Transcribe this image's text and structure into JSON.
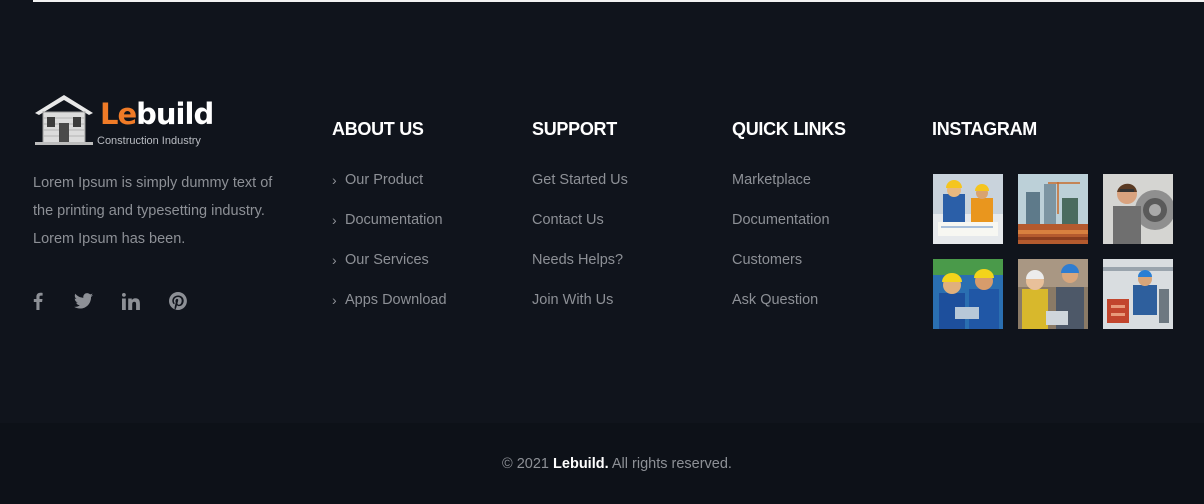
{
  "brand": {
    "logo_prefix": "Le",
    "logo_suffix": "build",
    "tagline": "Construction Industry",
    "about": "Lorem Ipsum is simply dummy text of the printing and typesetting industry. Lorem Ipsum has been.",
    "accent_color": "#f07b27"
  },
  "social": [
    {
      "name": "facebook",
      "icon": "facebook-icon"
    },
    {
      "name": "twitter",
      "icon": "twitter-icon"
    },
    {
      "name": "linkedin",
      "icon": "linkedin-icon"
    },
    {
      "name": "pinterest",
      "icon": "pinterest-icon"
    }
  ],
  "columns": {
    "about_us": {
      "title": "ABOUT US",
      "links": [
        "Our Product",
        "Documentation",
        "Our Services",
        "Apps Download"
      ]
    },
    "support": {
      "title": "SUPPORT",
      "links": [
        "Get Started Us",
        "Contact Us",
        "Needs Helps?",
        "Join With Us"
      ]
    },
    "quick_links": {
      "title": "QUICK LINKS",
      "links": [
        "Marketplace",
        "Documentation",
        "Customers",
        "Ask Question"
      ]
    },
    "instagram": {
      "title": "INSTAGRAM",
      "photos": [
        "instagram-photo-workers-blueprints",
        "instagram-photo-construction-site",
        "instagram-photo-woman-mechanic",
        "instagram-photo-hardhat-engineers",
        "instagram-photo-engineers-laptop",
        "instagram-photo-worker-machinery"
      ]
    }
  },
  "copyright": {
    "prefix": "© 2021",
    "brand": "Lebuild.",
    "suffix": "All rights reserved."
  },
  "colors": {
    "background": "#10141c",
    "bottom_bar": "#0d1118",
    "heading": "#ffffff",
    "muted_text": "#8d9096"
  }
}
